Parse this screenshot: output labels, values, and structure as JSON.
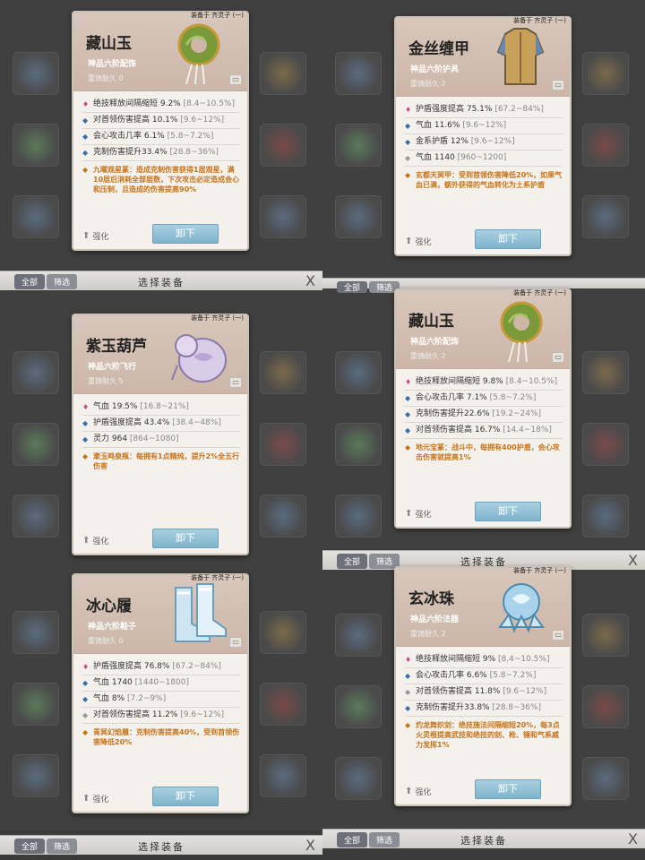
{
  "cards": [
    {
      "id": "c1",
      "equipped": "装备于 齐灵子 (一)",
      "name": "藏山玉",
      "grade": "神品六阶配饰",
      "refine_label": "重铸耐久",
      "refine_value": "0",
      "stats": [
        {
          "icon": "pink",
          "text": "绝技释放间隔缩短 9.2%",
          "range": " [8.4~10.5%]"
        },
        {
          "icon": "blue",
          "text": "对首领伤害提高 10.1%",
          "range": " [9.6~12%]"
        },
        {
          "icon": "blue",
          "text": "会心攻击几率 6.1%",
          "range": " [5.8~7.2%]"
        },
        {
          "icon": "blue",
          "text": "克制伤害提升33.4%",
          "range": " [28.8~36%]"
        }
      ],
      "special": "九曜观星篆：造成克制伤害获得1层观星，满10层后消耗全部层数，下次攻击必定造成会心和压制，且造成的伤害提高90%",
      "strengthen": "强化",
      "unequip": "卸下"
    },
    {
      "id": "c2",
      "equipped": "装备于 齐灵子 (一)",
      "name": "金丝缠甲",
      "grade": "神品六阶护具",
      "refine_label": "重铸耐久",
      "refine_value": "2",
      "stats": [
        {
          "icon": "pink",
          "text": "护盾强度提高 75.1%",
          "range": " [67.2~84%]"
        },
        {
          "icon": "blue",
          "text": "气血 11.6%",
          "range": " [9.6~12%]"
        },
        {
          "icon": "blue",
          "text": "金系护盾 12%",
          "range": " [9.6~12%]"
        },
        {
          "icon": "grey",
          "text": "气血 1140",
          "range": " [960~1200]"
        }
      ],
      "special": "玄都天冥甲：受到首领伤害降低20%，如果气血已满，额外获得的气血转化为土系护盾",
      "strengthen": "强化",
      "unequip": "卸下"
    },
    {
      "id": "c3",
      "equipped": "装备于 齐灵子 (一)",
      "name": "紫玉葫芦",
      "grade": "神品六阶飞行",
      "refine_label": "重铸耐久",
      "refine_value": "5",
      "stats": [
        {
          "icon": "pink",
          "text": "气血 19.5%",
          "range": " [16.8~21%]"
        },
        {
          "icon": "blue",
          "text": "护盾强度提高 43.4%",
          "range": " [38.4~48%]"
        },
        {
          "icon": "blue",
          "text": "灵力 964",
          "range": " [864~1080]"
        }
      ],
      "special": "漱玉鸣泉瓶：每拥有1点精纯，提升2%全五行伤害",
      "strengthen": "强化",
      "unequip": "卸下"
    },
    {
      "id": "c4",
      "equipped": "装备于 齐灵子 (一)",
      "name": "藏山玉",
      "grade": "神品六阶配饰",
      "refine_label": "重铸耐久",
      "refine_value": "2",
      "stats": [
        {
          "icon": "pink",
          "text": "绝技释放间隔缩短 9.8%",
          "range": " [8.4~10.5%]"
        },
        {
          "icon": "blue",
          "text": "会心攻击几率 7.1%",
          "range": " [5.8~7.2%]"
        },
        {
          "icon": "blue",
          "text": "克制伤害提升22.6%",
          "range": " [19.2~24%]"
        },
        {
          "icon": "blue",
          "text": "对首领伤害提高 16.7%",
          "range": " [14.4~18%]"
        }
      ],
      "special": "地元宝篆：战斗中，每拥有400护盾，会心攻击伤害就提高1%",
      "strengthen": "强化",
      "unequip": "卸下"
    },
    {
      "id": "c5",
      "equipped": "装备于 齐灵子 (一)",
      "name": "冰心履",
      "grade": "神品六阶鞋子",
      "refine_label": "重铸耐久",
      "refine_value": "0",
      "stats": [
        {
          "icon": "pink",
          "text": "护盾强度提高 76.8%",
          "range": " [67.2~84%]"
        },
        {
          "icon": "blue",
          "text": "气血 1740",
          "range": " [1440~1800]"
        },
        {
          "icon": "blue",
          "text": "气血 8%",
          "range": " [7.2~9%]"
        },
        {
          "icon": "grey",
          "text": "对首领伤害提高 11.2%",
          "range": " [9.6~12%]"
        }
      ],
      "special": "青冥幻焰履：克制伤害提高40%，受到首领伤害降低20%",
      "strengthen": "强化",
      "unequip": "卸下"
    },
    {
      "id": "c6",
      "equipped": "装备于 齐灵子 (一)",
      "name": "玄冰珠",
      "grade": "神品六阶法器",
      "refine_label": "重铸耐久",
      "refine_value": "2",
      "stats": [
        {
          "icon": "pink",
          "text": "绝技释放间隔缩短 9%",
          "range": " [8.4~10.5%]"
        },
        {
          "icon": "blue",
          "text": "会心攻击几率 6.6%",
          "range": " [5.8~7.2%]"
        },
        {
          "icon": "grey",
          "text": "对首领伤害提高 11.8%",
          "range": " [9.6~12%]"
        },
        {
          "icon": "blue",
          "text": "克制伤害提升33.8%",
          "range": " [28.8~36%]"
        }
      ],
      "special": "灼龙舞炽剑：绝技施法间隔缩短20%，每3点火灵根提高武技和绝技的剑、枪、锤和气系威力发挥1%",
      "strengthen": "强化",
      "unequip": "卸下"
    }
  ],
  "selbar": {
    "tab_all": "全部",
    "tab_filter": "筛选",
    "title": "选择装备",
    "close": "X"
  },
  "colors": {
    "special": "#c8741a",
    "unequip": "#8fbfd4"
  }
}
